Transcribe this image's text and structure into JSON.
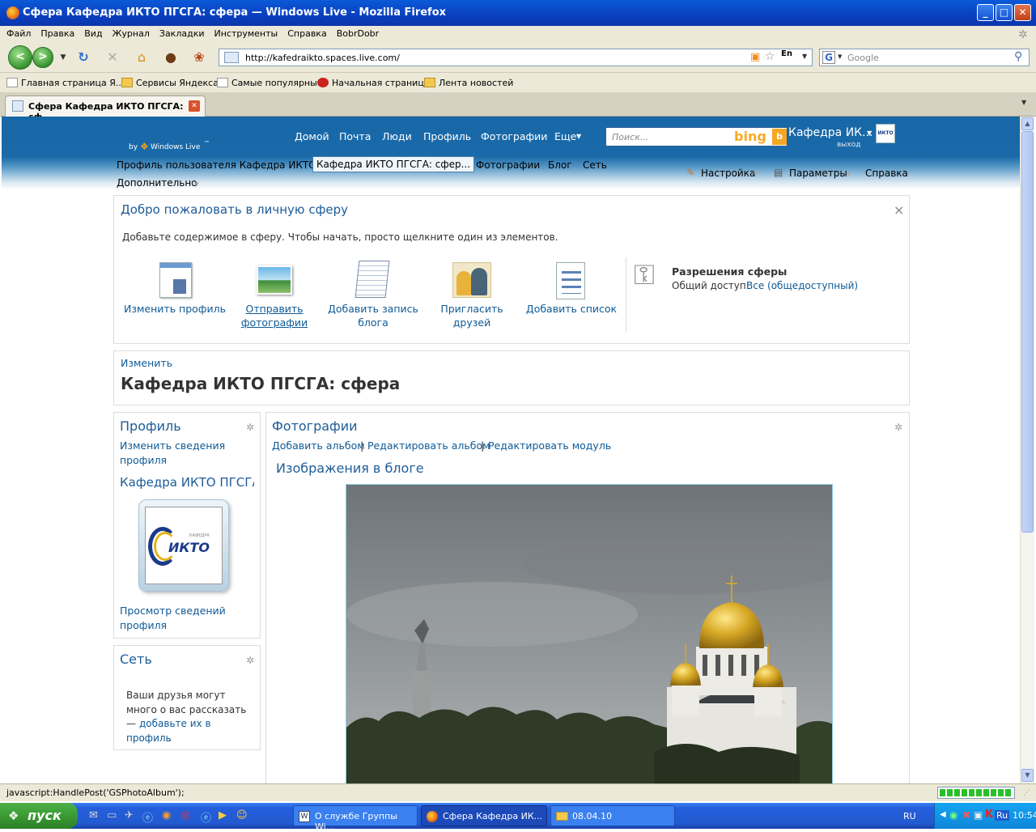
{
  "window": {
    "title": "Сфера Кафедра ИКТО ПГСГА: сфера — Windows Live - Mozilla Firefox"
  },
  "menu": [
    "Файл",
    "Правка",
    "Вид",
    "Журнал",
    "Закладки",
    "Инструменты",
    "Справка",
    "BobrDobr"
  ],
  "navbar": {
    "url": "http://kafedraikto.spaces.live.com/",
    "lang_badge": "En",
    "search_placeholder": "Google"
  },
  "bookmarks": [
    "Главная страница Я...",
    "Сервисы Яндекса",
    "Самые популярные",
    "Начальная страница",
    "Лента новостей"
  ],
  "tab": {
    "label": "Сфера Кафедра ИКТО ПГСГА: сф..."
  },
  "wl": {
    "byline": "by",
    "brand": "Windows Live",
    "brand_tm": "™",
    "nav": [
      "Домой",
      "Почта",
      "Люди",
      "Профиль",
      "Фотографии",
      "Еще"
    ],
    "search_placeholder": "Поиск...",
    "bing": "bing",
    "user_name": "Кафедра ИК...",
    "signout": "выход",
    "avatar_text": "ИКТО",
    "subnav": [
      "Профиль пользователя Кафедра ИКТО",
      "Кафедра ИКТО ПГСГА: сфер...",
      "Фотографии",
      "Блог",
      "Сеть"
    ],
    "subnav_more": "Дополнительно",
    "right_links": [
      "Настройка",
      "Параметры",
      "Справка"
    ]
  },
  "welcome": {
    "title": "Добро пожаловать в личную сферу",
    "close": "×",
    "text": "Добавьте содержимое в сферу. Чтобы начать, просто щелкните один из элементов.",
    "items": [
      {
        "label1": "Изменить профиль",
        "label2": ""
      },
      {
        "label1": "Отправить",
        "label2": "фотографии"
      },
      {
        "label1": "Добавить запись",
        "label2": "блога"
      },
      {
        "label1": "Пригласить друзей",
        "label2": ""
      },
      {
        "label1": "Добавить список",
        "label2": ""
      }
    ],
    "perm_title": "Разрешения сферы",
    "perm_label": "Общий доступ:",
    "perm_value": "Все (общедоступный)"
  },
  "space": {
    "edit": "Изменить",
    "title": "Кафедра ИКТО ПГСГА: сфера"
  },
  "profile": {
    "heading": "Профиль",
    "edit_line1": "Изменить сведения",
    "edit_line2": "профиля",
    "name": "Кафедра ИКТО ПГСГА",
    "logo_text": "ИКТО",
    "logo_small": "КАФЕДРА",
    "view_line1": "Просмотр сведений",
    "view_line2": "профиля"
  },
  "network": {
    "heading": "Сеть",
    "text1": "Ваши друзья могут",
    "text2": "много о вас рассказать",
    "text3_prefix": "— ",
    "link1": "добавьте их в",
    "link2": "профиль",
    "text_end": "."
  },
  "photos": {
    "heading": "Фотографии",
    "links": [
      "Добавить альбом",
      "Редактировать альбом",
      "Редактировать модуль"
    ],
    "separator": "|",
    "album_title": "Изображения в блоге"
  },
  "statusbar": {
    "text": "javascript:HandlePost('GSPhotoAlbum');",
    "progress": 1.0
  },
  "taskbar": {
    "start": "пуск",
    "tasks": [
      "О службе Группы Wi...",
      "Сфера Кафедра ИК...",
      "08.04.10"
    ],
    "lang": "RU",
    "tray_lang": "Ru",
    "clock": "10:54"
  }
}
